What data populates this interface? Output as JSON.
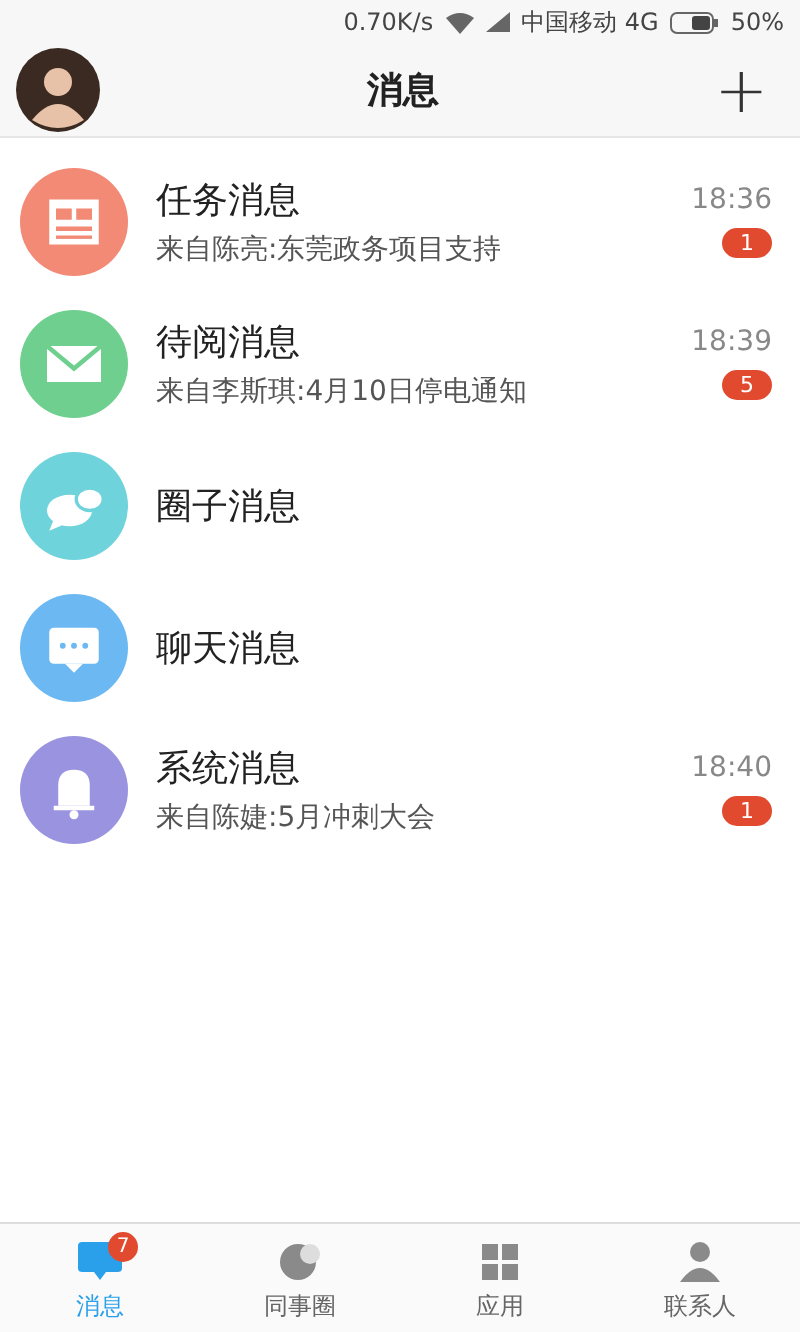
{
  "status_bar": {
    "speed": "0.70K/s",
    "carrier": "中国移动 4G",
    "battery": "50%"
  },
  "header": {
    "title": "消息",
    "add": "+"
  },
  "messages": [
    {
      "kind": "doc",
      "color": "#f28a76",
      "title": "任务消息",
      "preview": "来自陈亮:东莞政务项目支持",
      "time": "18:36",
      "badge": "1"
    },
    {
      "kind": "mail",
      "color": "#6fcf8e",
      "title": "待阅消息",
      "preview": "来自李斯琪:4月10日停电通知",
      "time": "18:39",
      "badge": "5"
    },
    {
      "kind": "bubbles",
      "color": "#6fd3dc",
      "title": "圈子消息"
    },
    {
      "kind": "chat",
      "color": "#6cb8f2",
      "title": "聊天消息"
    },
    {
      "kind": "bell",
      "color": "#9a93e0",
      "title": "系统消息",
      "preview": "来自陈婕:5月冲刺大会",
      "time": "18:40",
      "badge": "1"
    }
  ],
  "tabs": [
    {
      "kind": "chat",
      "label": "消息",
      "selected": true,
      "badge": "7"
    },
    {
      "kind": "moon",
      "label": "同事圈",
      "selected": false
    },
    {
      "kind": "grid",
      "label": "应用",
      "selected": false
    },
    {
      "kind": "person",
      "label": "联系人",
      "selected": false
    }
  ]
}
